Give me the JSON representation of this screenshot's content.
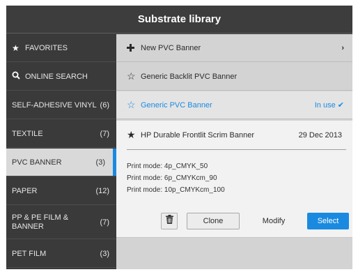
{
  "title": "Substrate library",
  "sidebar": {
    "items": [
      {
        "label": "FAVORITES",
        "count": "",
        "icon": "star-icon"
      },
      {
        "label": "ONLINE SEARCH",
        "count": "",
        "icon": "search-icon"
      },
      {
        "label": "SELF-ADHESIVE VINYL",
        "count": "(6)"
      },
      {
        "label": "TEXTILE",
        "count": "(7)"
      },
      {
        "label": "PVC BANNER",
        "count": "(3)",
        "selected": true
      },
      {
        "label": "PAPER",
        "count": "(12)"
      },
      {
        "label": "PP & PE FILM & BANNER",
        "count": "(7)"
      },
      {
        "label": "PET FILM",
        "count": "(3)"
      }
    ]
  },
  "main": {
    "new_item": {
      "label": "New PVC Banner",
      "icon": "plus-icon"
    },
    "rows": [
      {
        "label": "Generic Backlit PVC Banner",
        "icon": "star-outline-icon"
      },
      {
        "label": "Generic PVC Banner",
        "icon": "star-outline-icon",
        "status": "In use",
        "active": true
      }
    ],
    "detail": {
      "name": "HP Durable Frontlit Scrim Banner",
      "date": "29 Dec 2013",
      "icon": "star-filled-icon",
      "print_modes": [
        "Print mode:  4p_CMYK_50",
        "Print mode:  6p_CMYKcm_90",
        "Print mode:  10p_CMYKcm_100"
      ],
      "buttons": {
        "clone": "Clone",
        "modify": "Modify",
        "select": "Select"
      }
    }
  },
  "colors": {
    "accent": "#1a8ae0",
    "sidebar_bg": "#3a3a3a",
    "main_bg": "#d3d3d3"
  }
}
